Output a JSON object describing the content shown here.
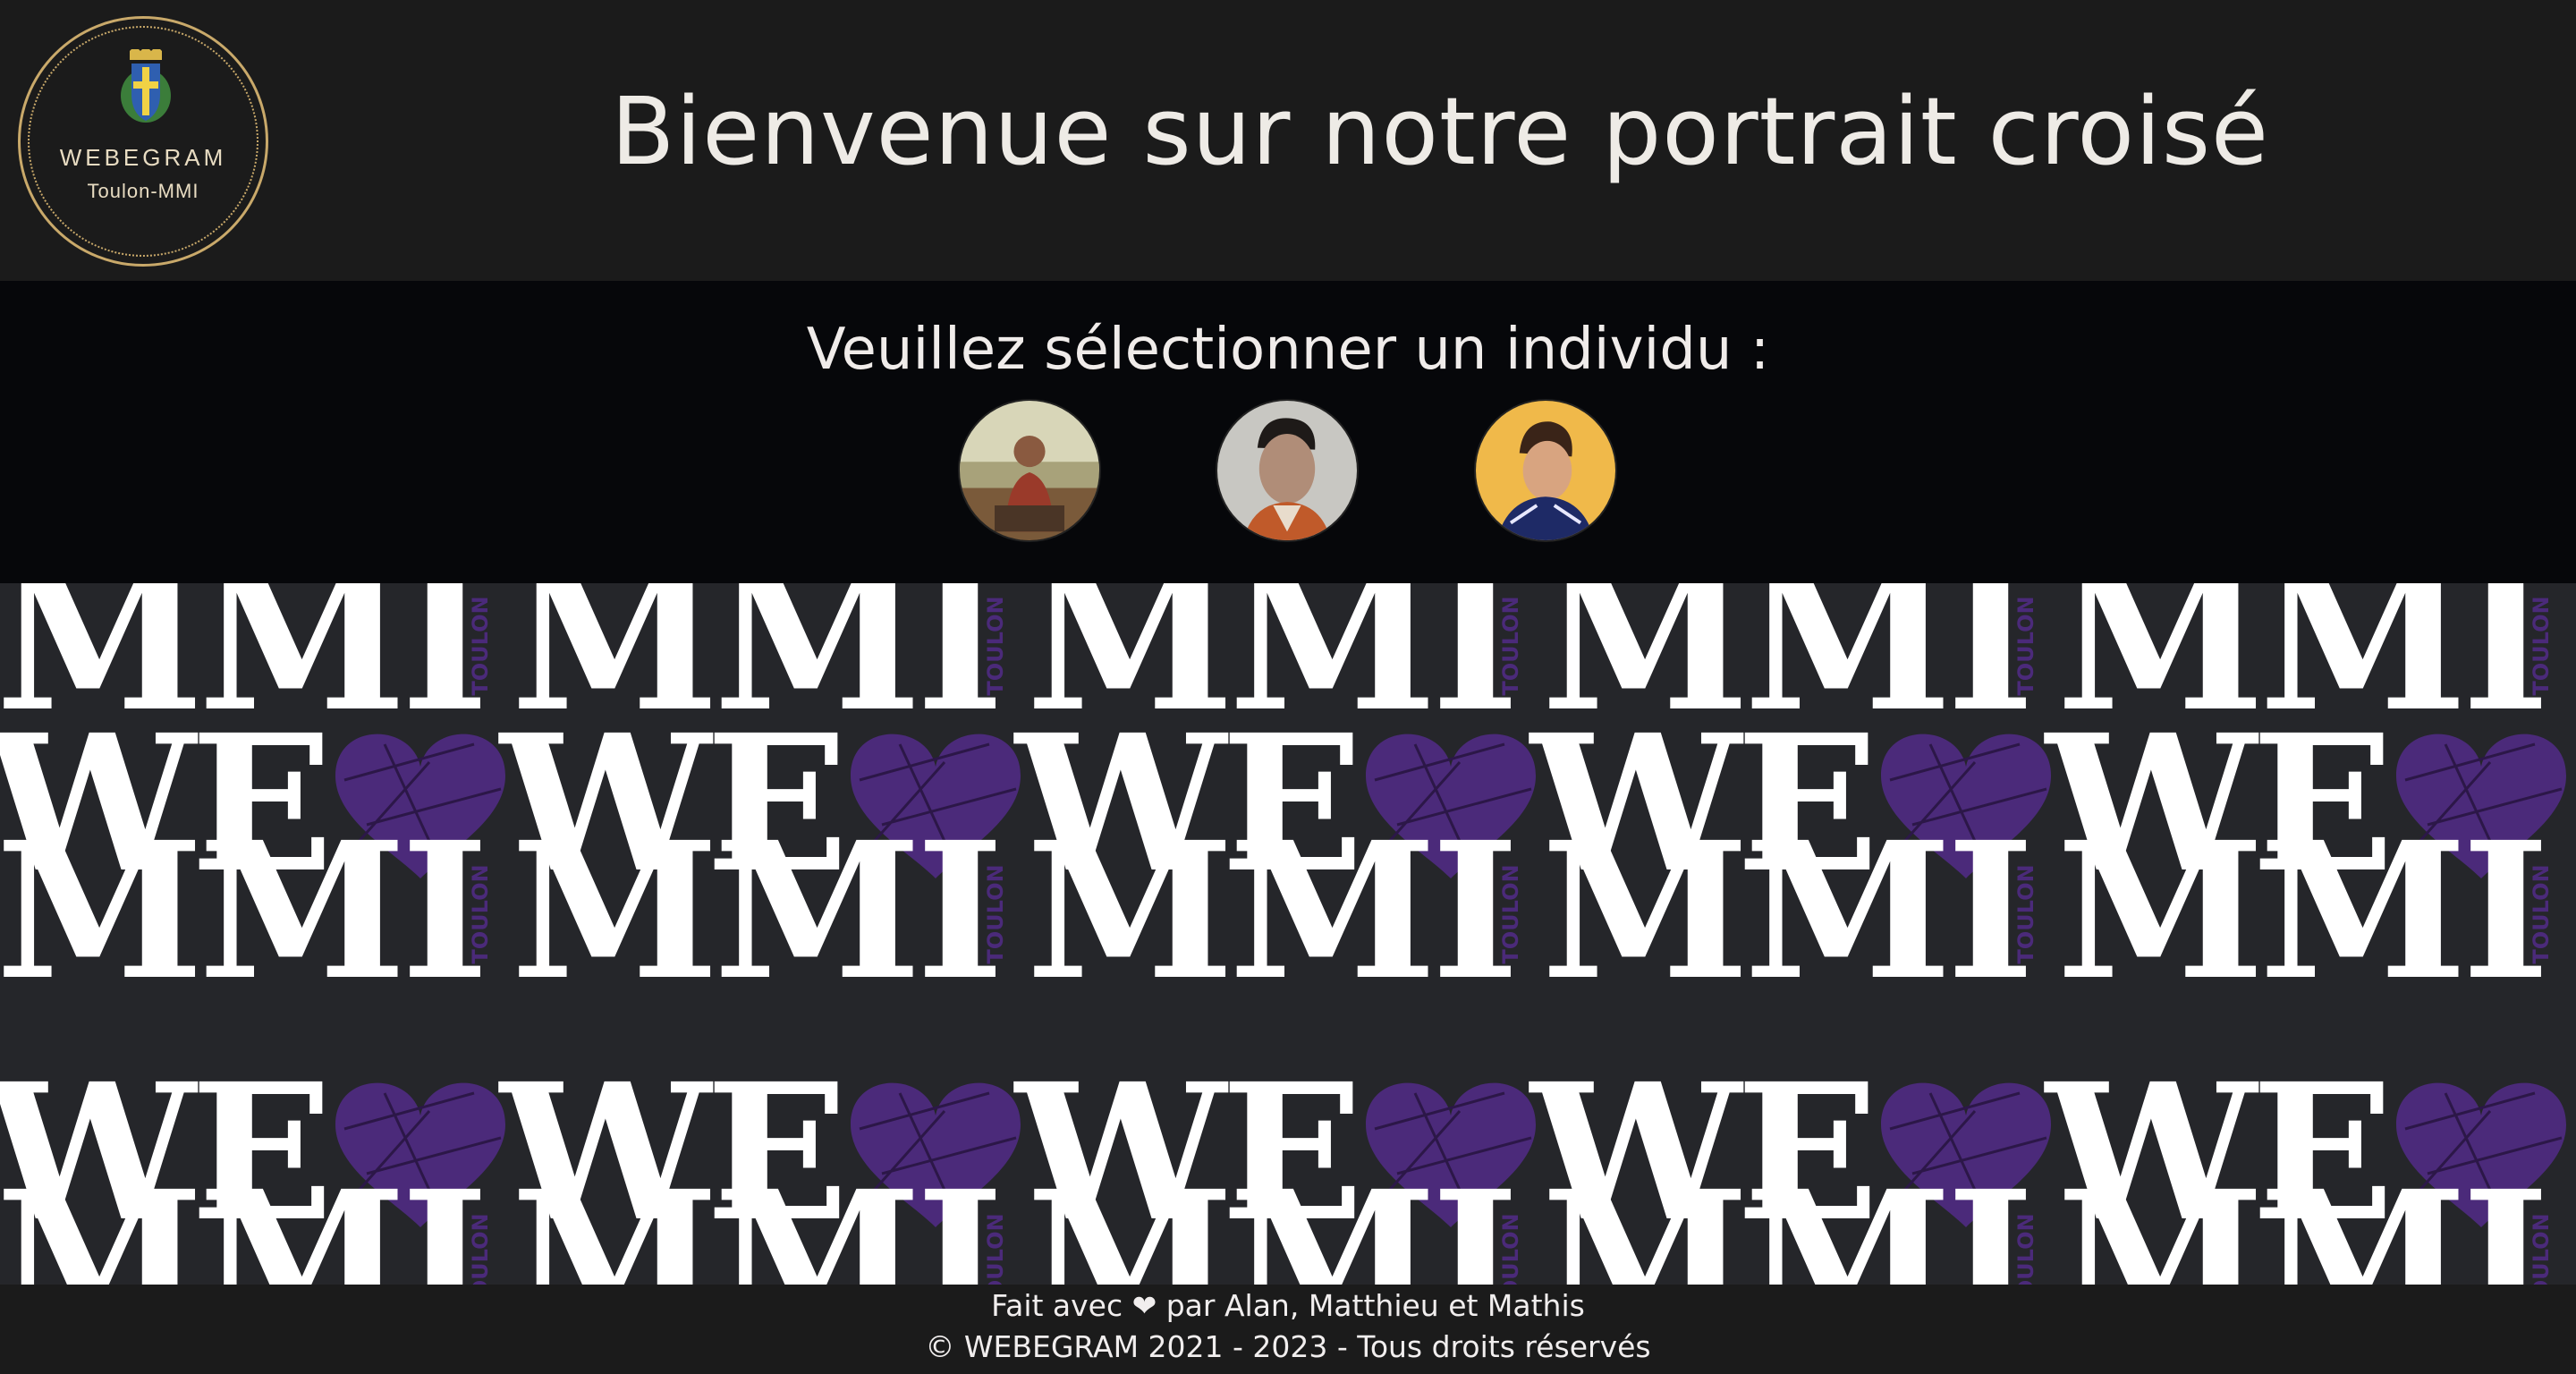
{
  "header": {
    "logo": {
      "name": "WEBEGRAM",
      "subtitle": "Toulon-MMI",
      "icon": "crest-icon",
      "accent": "#c9a96a"
    },
    "title": "Bienvenue sur notre portrait croisé"
  },
  "selection": {
    "label": "Veuillez sélectionner un individu :",
    "people": [
      {
        "name": "avatar-1",
        "icon": "portrait-beach"
      },
      {
        "name": "avatar-2",
        "icon": "portrait-studio"
      },
      {
        "name": "avatar-3",
        "icon": "portrait-yellow"
      }
    ]
  },
  "pattern": {
    "word_top": "MMI",
    "word_bottom": "WE",
    "side_text": "TOULON",
    "heart_color": "#4b2a7a",
    "background": "#25262a"
  },
  "footer": {
    "made_with": "Fait avec ❤ par Alan, Matthieu et Mathis",
    "copyright": "© WEBEGRAM 2021 - 2023 - Tous droits réservés"
  }
}
